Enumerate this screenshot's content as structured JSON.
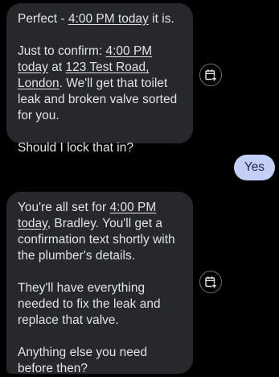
{
  "messages": [
    {
      "role": "assistant",
      "paragraphs": {
        "p1": {
          "before": "Perfect - ",
          "time_link": "4:00 PM today",
          "after": " it is."
        },
        "p2": {
          "before": "Just to confirm: ",
          "time_link": "4:00 PM today",
          "middle": " at ",
          "address_link": "123 Test Road, London",
          "after": ". We'll get that toilet leak and broken valve sorted for you."
        },
        "p3": {
          "text": "Should I lock that in?"
        }
      },
      "action_icon": "calendar-add-icon"
    },
    {
      "role": "user",
      "text": "Yes"
    },
    {
      "role": "assistant",
      "paragraphs": {
        "p1": {
          "before": "You're all set for ",
          "time_link": "4:00 PM today",
          "after": ", Bradley. You'll get a confirmation text shortly with the plumber's details."
        },
        "p2": {
          "text": "They'll have everything needed to fix the leak and replace that valve."
        },
        "p3": {
          "text": "Anything else you need before then?"
        }
      },
      "action_icon": "calendar-add-icon"
    }
  ],
  "colors": {
    "background": "#000000",
    "assistant_bubble": "#27282c",
    "user_bubble": "#c4cff7",
    "user_text": "#1b2246",
    "text": "#e4e3e8"
  }
}
